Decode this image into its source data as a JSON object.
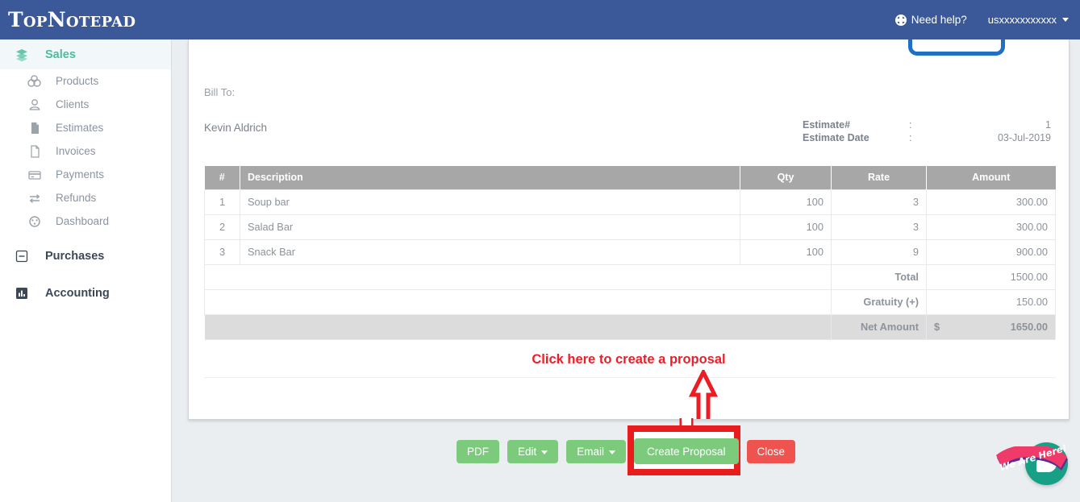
{
  "app": {
    "brand": "TopNotepad",
    "need_help": "Need help?",
    "username": "usxxxxxxxxxxx",
    "brand_color": "#3b5998"
  },
  "sidebar": {
    "groups": [
      {
        "label": "Sales",
        "icon": "layers-icon",
        "active": true
      },
      {
        "label": "Purchases",
        "icon": "minus-square-icon",
        "active": false
      },
      {
        "label": "Accounting",
        "icon": "bar-chart-icon",
        "active": false
      }
    ],
    "sales_items": [
      {
        "label": "Products",
        "icon": "products-icon"
      },
      {
        "label": "Clients",
        "icon": "user-icon"
      },
      {
        "label": "Estimates",
        "icon": "file-filled-icon"
      },
      {
        "label": "Invoices",
        "icon": "file-icon"
      },
      {
        "label": "Payments",
        "icon": "credit-card-icon"
      },
      {
        "label": "Refunds",
        "icon": "exchange-icon"
      },
      {
        "label": "Dashboard",
        "icon": "gauge-icon"
      }
    ],
    "active_color": "#4bbd9a"
  },
  "document": {
    "bill_to_label": "Bill To:",
    "client_name": "Kevin Aldrich",
    "meta": [
      {
        "label": "Estimate#",
        "sep": ":",
        "value": "1"
      },
      {
        "label": "Estimate Date",
        "sep": ":",
        "value": "03-Jul-2019"
      }
    ],
    "table": {
      "headers": [
        "#",
        "Description",
        "Qty",
        "Rate",
        "Amount"
      ],
      "rows": [
        {
          "num": "1",
          "description": "Soup bar",
          "qty": "100",
          "rate": "3",
          "amount": "300.00"
        },
        {
          "num": "2",
          "description": "Salad Bar",
          "qty": "100",
          "rate": "3",
          "amount": "300.00"
        },
        {
          "num": "3",
          "description": "Snack Bar",
          "qty": "100",
          "rate": "9",
          "amount": "900.00"
        }
      ],
      "totals": [
        {
          "label": "Total",
          "currency": "",
          "value": "1500.00"
        },
        {
          "label": "Gratuity (+)",
          "currency": "",
          "value": "150.00"
        },
        {
          "label": "Net Amount",
          "currency": "$",
          "value": "1650.00"
        }
      ]
    }
  },
  "annotation": {
    "text": "Click here to create a proposal",
    "color": "#f01c28"
  },
  "footer": {
    "buttons": [
      {
        "label": "PDF",
        "style": "green",
        "caret": false
      },
      {
        "label": "Edit",
        "style": "green",
        "caret": true
      },
      {
        "label": "Email",
        "style": "green",
        "caret": true
      },
      {
        "label": "Create Proposal",
        "style": "green",
        "caret": false
      },
      {
        "label": "Close",
        "style": "red",
        "caret": false
      }
    ]
  },
  "chat": {
    "banner": "We Are Here!",
    "bubble_color": "#17a086",
    "banner_color": "#ef3a6a"
  }
}
